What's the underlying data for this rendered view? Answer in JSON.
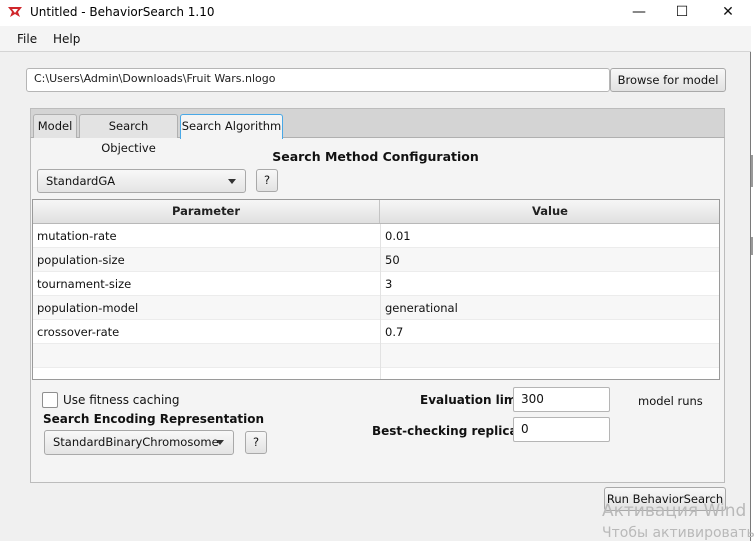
{
  "window": {
    "title": "Untitled - BehaviorSearch 1.10",
    "controls": {
      "minimize": "—",
      "maximize": "☐",
      "close": "✕"
    }
  },
  "menu": {
    "items": [
      "File",
      "Help"
    ]
  },
  "model": {
    "path": "C:\\Users\\Admin\\Downloads\\Fruit Wars.nlogo",
    "browse_label": "Browse for model"
  },
  "tabs": [
    {
      "label": "Model",
      "active": false
    },
    {
      "label": "Search Objective",
      "active": false
    },
    {
      "label": "Search Algorithm",
      "active": true
    }
  ],
  "algorithm": {
    "section_title": "Search Method Configuration",
    "method": "StandardGA",
    "help_label": "?"
  },
  "table": {
    "headers": [
      "Parameter",
      "Value"
    ],
    "rows": [
      {
        "param": "mutation-rate",
        "value": "0.01"
      },
      {
        "param": "population-size",
        "value": "50"
      },
      {
        "param": "tournament-size",
        "value": "3"
      },
      {
        "param": "population-model",
        "value": "generational"
      },
      {
        "param": "crossover-rate",
        "value": "0.7"
      },
      {
        "param": "",
        "value": ""
      },
      {
        "param": "",
        "value": ""
      }
    ]
  },
  "options": {
    "fitness_caching_label": "Use fitness caching",
    "fitness_caching_checked": false,
    "encoding_title": "Search Encoding Representation",
    "encoding_value": "StandardBinaryChromosome",
    "evaluation_limit_label": "Evaluation limit:",
    "evaluation_limit_value": "300",
    "evaluation_limit_units": "model runs",
    "replicates_label": "Best-checking replicates:",
    "replicates_value": "0"
  },
  "run_label": "Run BehaviorSearch",
  "watermark": {
    "line1": "Активация Wind",
    "line2": "Чтобы активировать"
  },
  "colors": {
    "accent": "#49a8e6",
    "brand_icon": "#d0262b"
  }
}
